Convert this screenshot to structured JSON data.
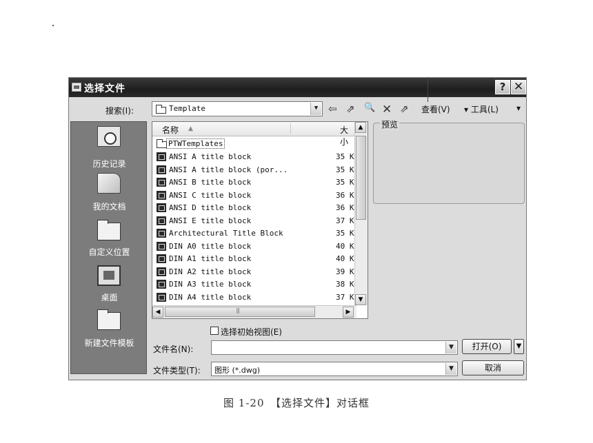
{
  "dialog": {
    "title": "选择文件",
    "help_label": "?",
    "close_label": "✕"
  },
  "lookin": {
    "label": "搜索(I):",
    "value": "Template"
  },
  "toolbar": {
    "back_icon": "⇦",
    "up_icon": "⇗",
    "search_icon": "🔍",
    "delete_icon": "✕",
    "newfolder_icon": "⇗",
    "view_label": "查看(V)",
    "tools_label": "▾ 工具(L)",
    "tools_arrow": "▾"
  },
  "places": [
    {
      "label": "历史记录",
      "icon": "history-icon"
    },
    {
      "label": "我的文档",
      "icon": "my-documents-icon"
    },
    {
      "label": "自定义位置",
      "icon": "folder-icon"
    },
    {
      "label": "桌面",
      "icon": "desktop-icon"
    },
    {
      "label": "新建文件模板",
      "icon": "folder-icon"
    }
  ],
  "filelist": {
    "col_name": "名称",
    "col_size": "大小",
    "folder": "PTWTemplates",
    "files": [
      {
        "name": "ANSI A title block",
        "size": "35 K"
      },
      {
        "name": "ANSI A title block (por...",
        "size": "35 K"
      },
      {
        "name": "ANSI B title block",
        "size": "35 K"
      },
      {
        "name": "ANSI C title block",
        "size": "36 K"
      },
      {
        "name": "ANSI D title block",
        "size": "36 K"
      },
      {
        "name": "ANSI E title block",
        "size": "37 K"
      },
      {
        "name": "Architectural Title Block",
        "size": "35 K"
      },
      {
        "name": "DIN A0 title block",
        "size": "40 K"
      },
      {
        "name": "DIN A1 title block",
        "size": "40 K"
      },
      {
        "name": "DIN A2 title block",
        "size": "39 K"
      },
      {
        "name": "DIN A3 title block",
        "size": "38 K"
      },
      {
        "name": "DIN A4 title block",
        "size": "37 K"
      }
    ]
  },
  "preview": {
    "label": "预览"
  },
  "initial_view": {
    "label": "选择初始视图(E)",
    "checked": false
  },
  "filename": {
    "label": "文件名(N):",
    "value": ""
  },
  "filetype": {
    "label": "文件类型(T):",
    "value": "图形 (*.dwg)"
  },
  "buttons": {
    "open": "打开(O)",
    "cancel": "取消"
  },
  "caption": "图 1-20　【选择文件】对话框"
}
